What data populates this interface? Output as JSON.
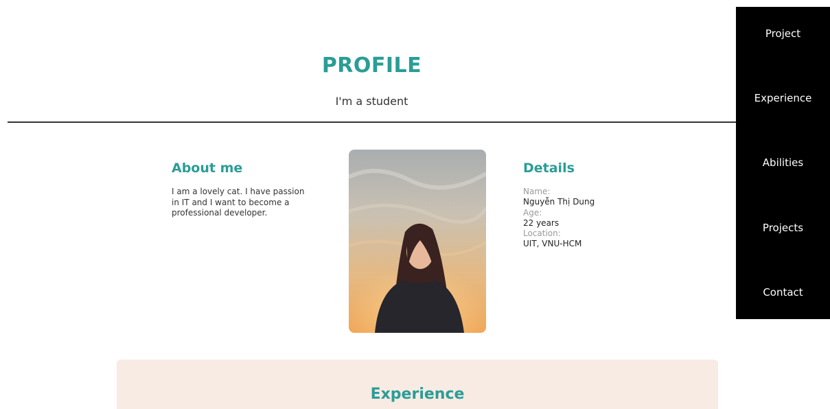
{
  "header": {
    "title": "PROFILE",
    "subtitle": "I'm a student"
  },
  "nav": {
    "items": [
      {
        "label": "Project"
      },
      {
        "label": "Experience"
      },
      {
        "label": "Abilities"
      },
      {
        "label": "Projects"
      },
      {
        "label": "Contact"
      }
    ]
  },
  "about": {
    "title": "About me",
    "text": "I am a lovely cat. I have passion in IT and I want to become a professional developer."
  },
  "details": {
    "title": "Details",
    "name_label": "Name:",
    "name_value": "Nguyễn Thị Dung",
    "age_label": "Age:",
    "age_value": "22 years",
    "location_label": "Location:",
    "location_value": "UIT, VNU-HCM"
  },
  "experience": {
    "title": "Experience"
  },
  "colors": {
    "accent": "#2a9d96",
    "nav_background": "#000000",
    "experience_background": "#f8ebe4"
  }
}
